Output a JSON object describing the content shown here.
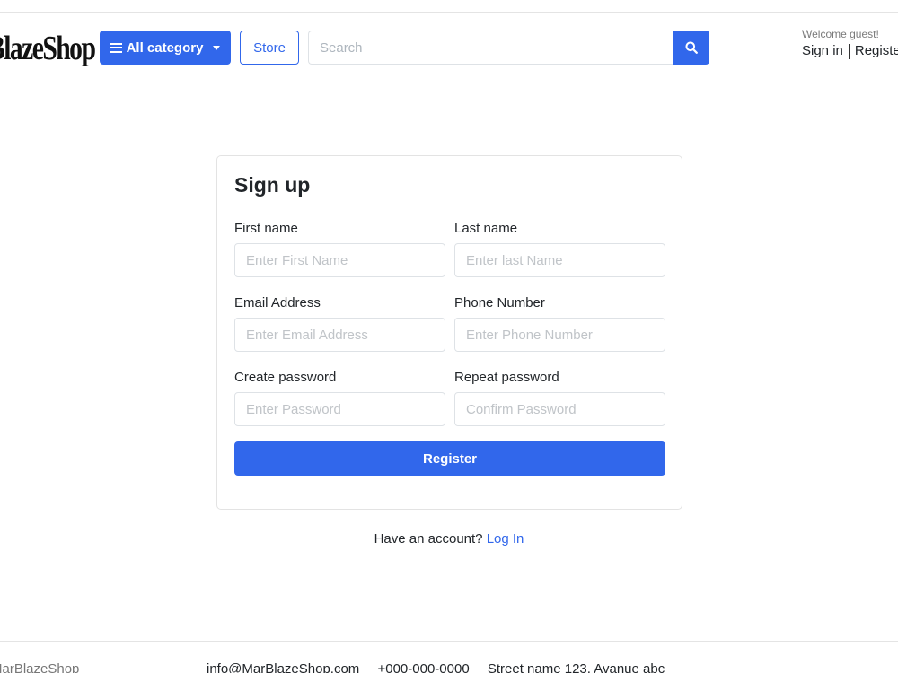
{
  "header": {
    "logo_text": "BlazeShop",
    "category_label": "All category",
    "store_label": "Store",
    "search_placeholder": "Search",
    "welcome_text": "Welcome guest!",
    "sign_in_label": "Sign in",
    "register_label": "Register"
  },
  "form": {
    "title": "Sign up",
    "first_name_label": "First name",
    "first_name_placeholder": "Enter First Name",
    "last_name_label": "Last name",
    "last_name_placeholder": "Enter last Name",
    "email_label": "Email Address",
    "email_placeholder": "Enter Email Address",
    "phone_label": "Phone Number",
    "phone_placeholder": "Enter Phone Number",
    "password_label": "Create password",
    "password_placeholder": "Enter Password",
    "repeat_password_label": "Repeat password",
    "repeat_password_placeholder": "Confirm Password",
    "register_button": "Register"
  },
  "login_prompt": {
    "text": "Have an account?",
    "link": "Log In"
  },
  "footer": {
    "brand": "MarBlazeShop",
    "email": "info@MarBlazeShop.com",
    "phone": "+000-000-0000",
    "address": "Street name 123, Avanue abc"
  },
  "colors": {
    "primary": "#3167eb",
    "border": "#dee2e6",
    "text": "#212529"
  }
}
